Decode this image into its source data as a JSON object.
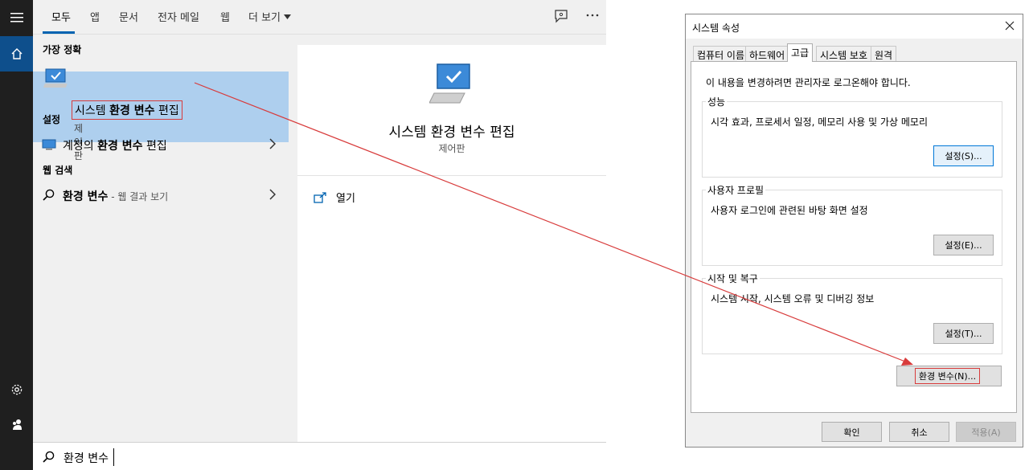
{
  "search": {
    "tabs": [
      "모두",
      "앱",
      "문서",
      "전자 메일",
      "웹"
    ],
    "more_label": "더 보기",
    "best_match_heading": "가장 정확",
    "best_match": {
      "title_plain": "시스템 ",
      "title_bold": "환경 변수",
      "title_tail": " 편집",
      "subtitle": "제어판"
    },
    "settings_heading": "설정",
    "settings_item": {
      "prefix": "계정의 ",
      "bold": "환경 변수",
      "suffix": " 편집"
    },
    "web_heading": "웹 검색",
    "web_item": {
      "bold": "환경 변수",
      "muted": " - 웹 결과 보기"
    },
    "preview": {
      "title": "시스템 환경 변수 편집",
      "subtitle": "제어판",
      "open_label": "열기"
    },
    "query": "환경 변수"
  },
  "dialog": {
    "title": "시스템 속성",
    "tabs": [
      "컴퓨터 이름",
      "하드웨어",
      "고급",
      "시스템 보호",
      "원격"
    ],
    "notice": "이 내용을 변경하려면 관리자로 로그온해야 합니다.",
    "performance": {
      "label": "성능",
      "desc": "시각 효과, 프로세서 일정, 메모리 사용 및 가상 메모리",
      "button": "설정(S)..."
    },
    "profile": {
      "label": "사용자 프로필",
      "desc": "사용자 로그인에 관련된 바탕 화면 설정",
      "button": "설정(E)..."
    },
    "startup": {
      "label": "시작 및 복구",
      "desc": "시스템 시작, 시스템 오류 및 디버깅 정보",
      "button": "설정(T)..."
    },
    "env_button": "환경 변수(N)...",
    "ok": "확인",
    "cancel": "취소",
    "apply": "적용(A)"
  },
  "colors": {
    "accent": "#0063b1",
    "highlight": "#aecfee",
    "annotation": "#d83b3b"
  }
}
